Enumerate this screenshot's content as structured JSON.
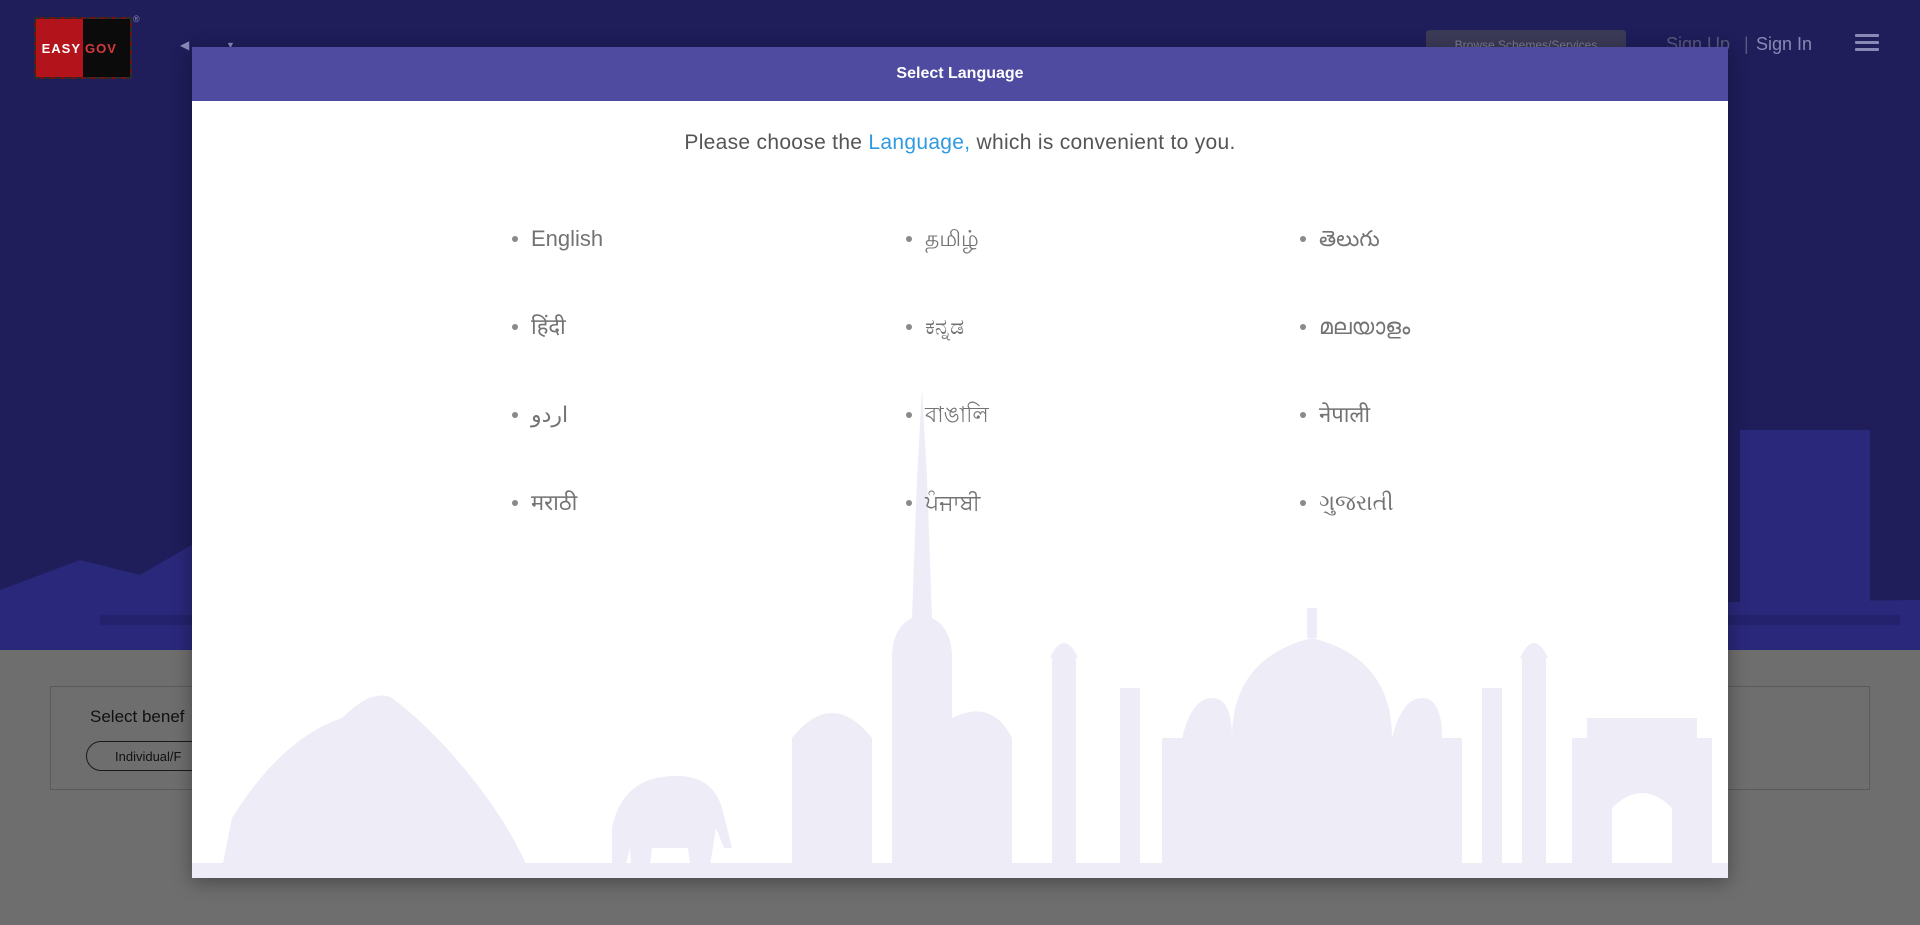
{
  "header": {
    "logo": {
      "left": "EASY",
      "right": "GOV",
      "registered_mark": "®"
    },
    "browse_button": "Browse Schemes/Services",
    "sign_up": "Sign Up",
    "separator": "|",
    "sign_in": "Sign In",
    "icons": {
      "back": "arrow-left-icon",
      "dropdown": "caret-down-icon",
      "menu": "hamburger-menu-icon"
    }
  },
  "beneficiary": {
    "label": "Select benef",
    "pill": "Individual/F"
  },
  "modal": {
    "title": "Select Language",
    "intro_before": "Please choose the ",
    "intro_highlight": "Language,",
    "intro_after": " which is convenient to you.",
    "languages": [
      [
        "English",
        "हिंदी",
        "اردو",
        "मराठी"
      ],
      [
        "தமிழ்",
        "ಕನ್ನಡ",
        "বাঙালি",
        "ਪੰਜਾਬੀ"
      ],
      [
        "తెలుగు",
        "മലയാളം",
        "नेपाली",
        "ગુજરાતી"
      ]
    ]
  },
  "colors": {
    "modal_header": "#4f4ba1",
    "highlight": "#2f9ae0",
    "hero_bg": "#1f1d5a",
    "skyline": "#edecf7"
  }
}
